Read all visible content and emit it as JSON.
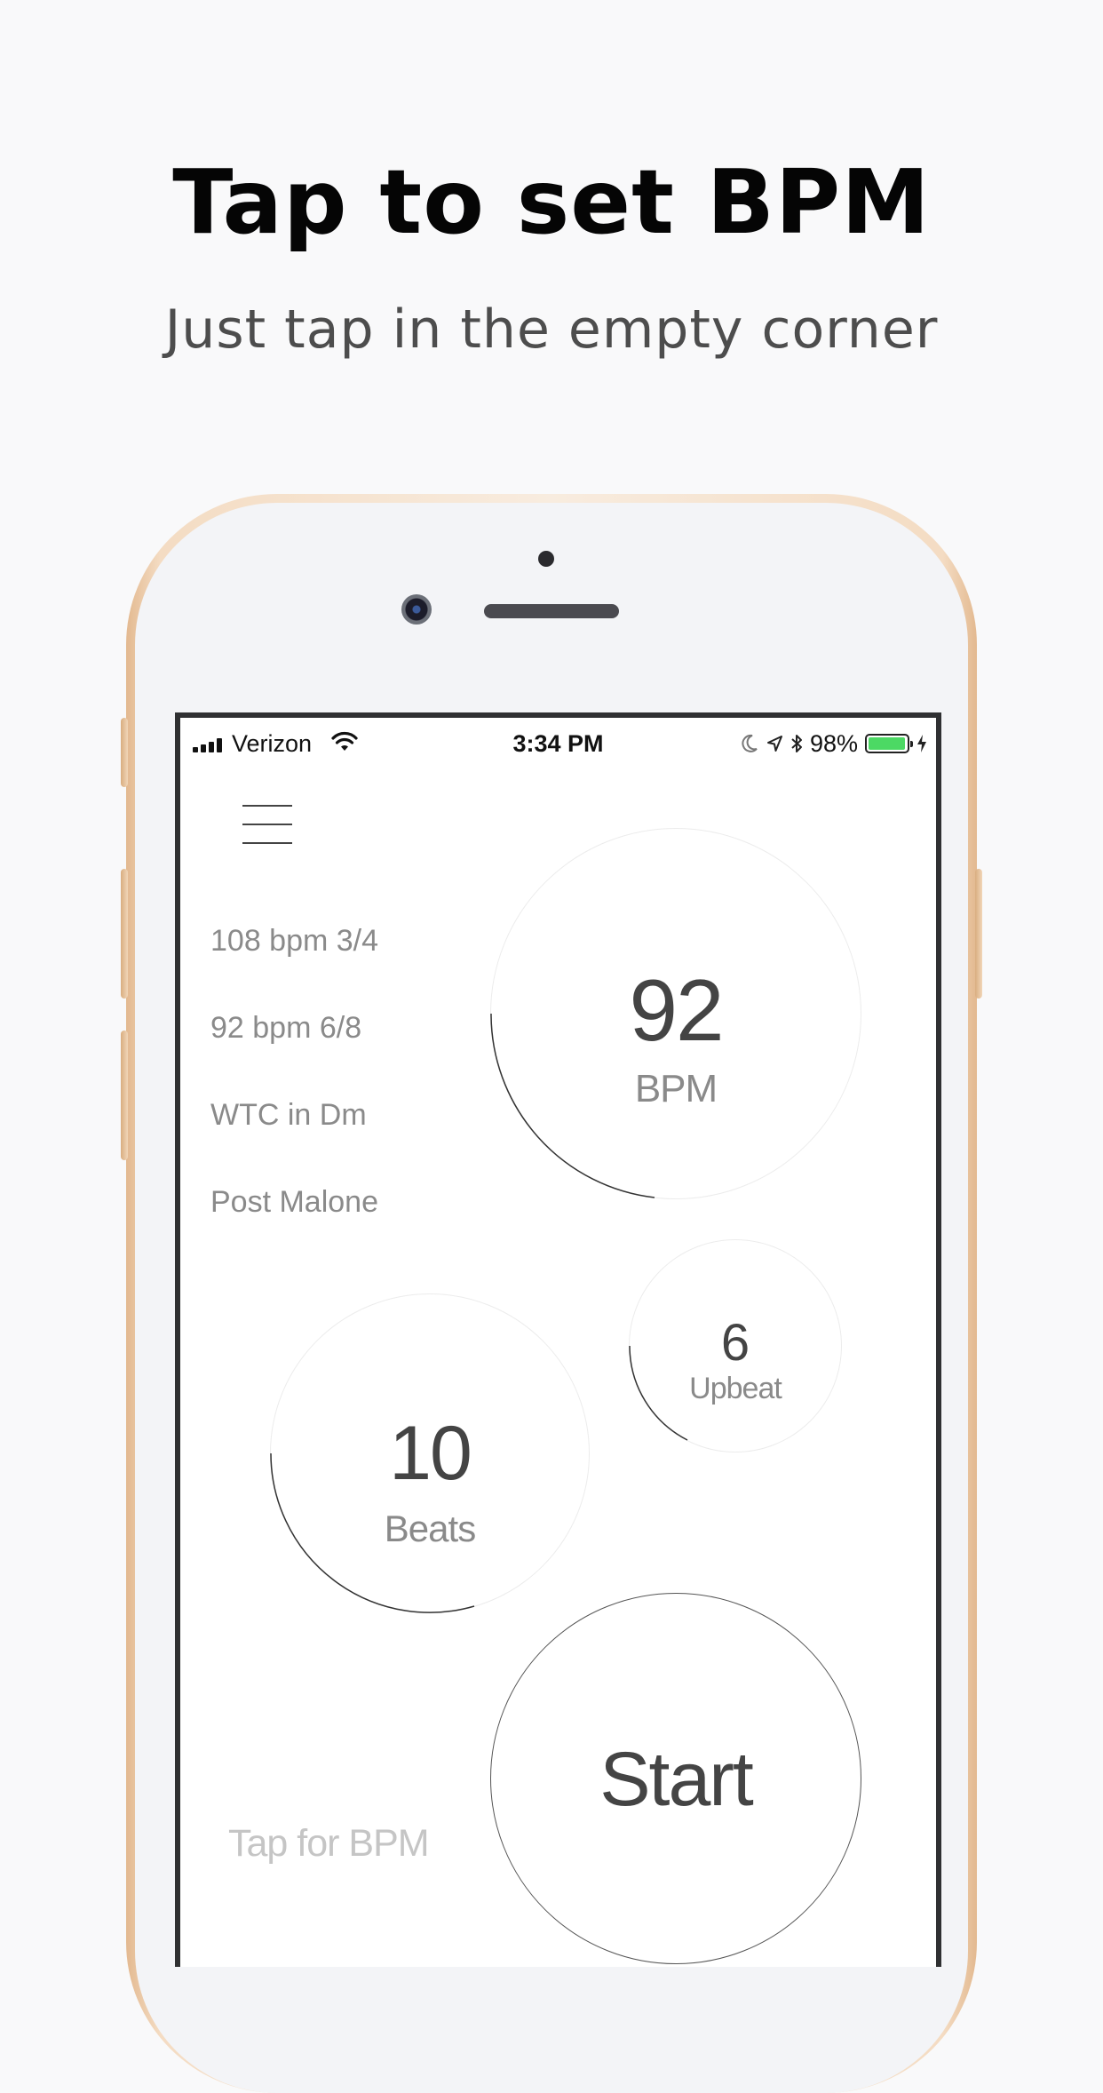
{
  "header": {
    "title": "Tap to set BPM",
    "subtitle": "Just tap in the empty corner"
  },
  "status_bar": {
    "carrier": "Verizon",
    "time": "3:34 PM",
    "battery": "98%",
    "battery_level": 0.98,
    "battery_color": "#4cd964",
    "icons": [
      "signal-icon",
      "wifi-icon",
      "moon-icon",
      "location-icon",
      "bluetooth-icon",
      "battery-icon",
      "charging-icon"
    ]
  },
  "app": {
    "menu_icon": "hamburger-menu-icon",
    "presets": [
      {
        "label": "108 bpm 3/4"
      },
      {
        "label": "92 bpm 6/8"
      },
      {
        "label": "WTC in Dm"
      },
      {
        "label": "Post Malone"
      }
    ],
    "bpm": {
      "value": "92",
      "label": "BPM"
    },
    "beats": {
      "value": "10",
      "label": "Beats"
    },
    "upbeat": {
      "value": "6",
      "label": "Upbeat"
    },
    "start": {
      "label": "Start"
    },
    "tap_hint": "Tap for BPM"
  }
}
